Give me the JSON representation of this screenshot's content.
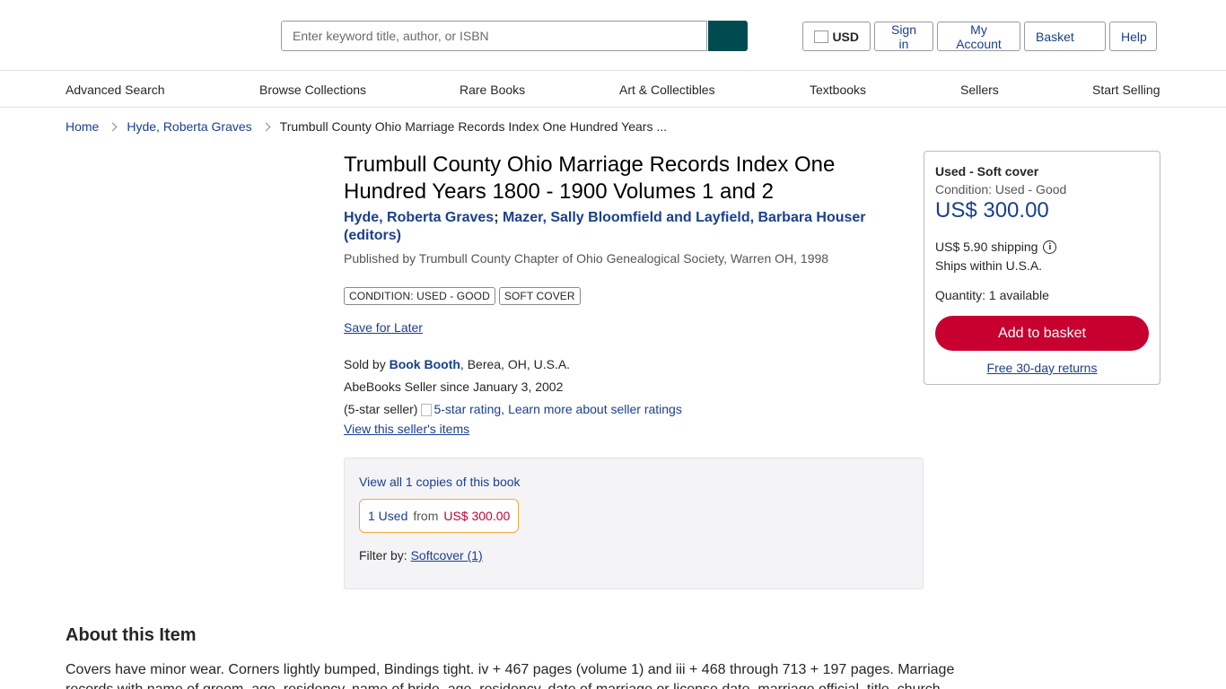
{
  "header": {
    "search_placeholder": "Enter keyword title, author, or ISBN",
    "currency_label": "USD",
    "sign_in_label": "Sign in",
    "my_account_label": "My Account",
    "basket_label": "Basket",
    "help_label": "Help",
    "accent_color": "#004b50"
  },
  "nav": {
    "items": [
      "Advanced Search",
      "Browse Collections",
      "Rare Books",
      "Art & Collectibles",
      "Textbooks",
      "Sellers",
      "Start Selling"
    ]
  },
  "breadcrumb": {
    "home": "Home",
    "author": "Hyde, Roberta Graves",
    "current": "Trumbull County Ohio Marriage Records Index One Hundred Years ..."
  },
  "book": {
    "title": "Trumbull County Ohio Marriage Records Index One Hundred Years 1800 - 1900 Volumes 1 and 2",
    "author1": "Hyde, Roberta Graves",
    "separator": ";",
    "author2": "Mazer, Sally Bloomfield and Layfield, Barbara Houser (editors)",
    "published": "Published by Trumbull County Chapter of Ohio Genealogical Society, Warren OH, 1998",
    "tags": [
      "Condition: Used - Good",
      "Soft cover"
    ],
    "save_for_later": "Save for Later"
  },
  "seller": {
    "sold_by_prefix": "Sold by",
    "name": "Book Booth",
    "location": ", Berea, OH, U.S.A.",
    "since": "AbeBooks Seller since January 3, 2002",
    "rating_text": "(5-star seller)",
    "rating_img_alt": "5-star rating,",
    "rating_link": "Learn more about seller ratings",
    "view_items": "View this seller's items"
  },
  "copies": {
    "view_all": "View all 1 copies of this book",
    "used_count": "1 Used",
    "from_label": "from",
    "used_price": "US$ 300.00",
    "filter_label": "Filter by:",
    "filter_option": "Softcover (1)"
  },
  "buybox": {
    "type": "Used - Soft cover",
    "condition": "Condition: Used - Good",
    "price": "US$ 300.00",
    "shipping": "US$ 5.90 shipping",
    "ships_within": "Ships within U.S.A.",
    "quantity": "Quantity: 1 available",
    "add_button": "Add to basket",
    "returns": "Free 30-day returns",
    "button_color": "#c70030"
  },
  "about": {
    "heading": "About this Item",
    "text": "Covers have minor wear. Corners lightly bumped, Bindings tight. iv + 467 pages (volume 1) and iii + 468 through 713 + 197 pages. Marriage records with name of groom, age, residency, name of bride, age, residency, date of marriage or license date, marriage official, title, church"
  }
}
